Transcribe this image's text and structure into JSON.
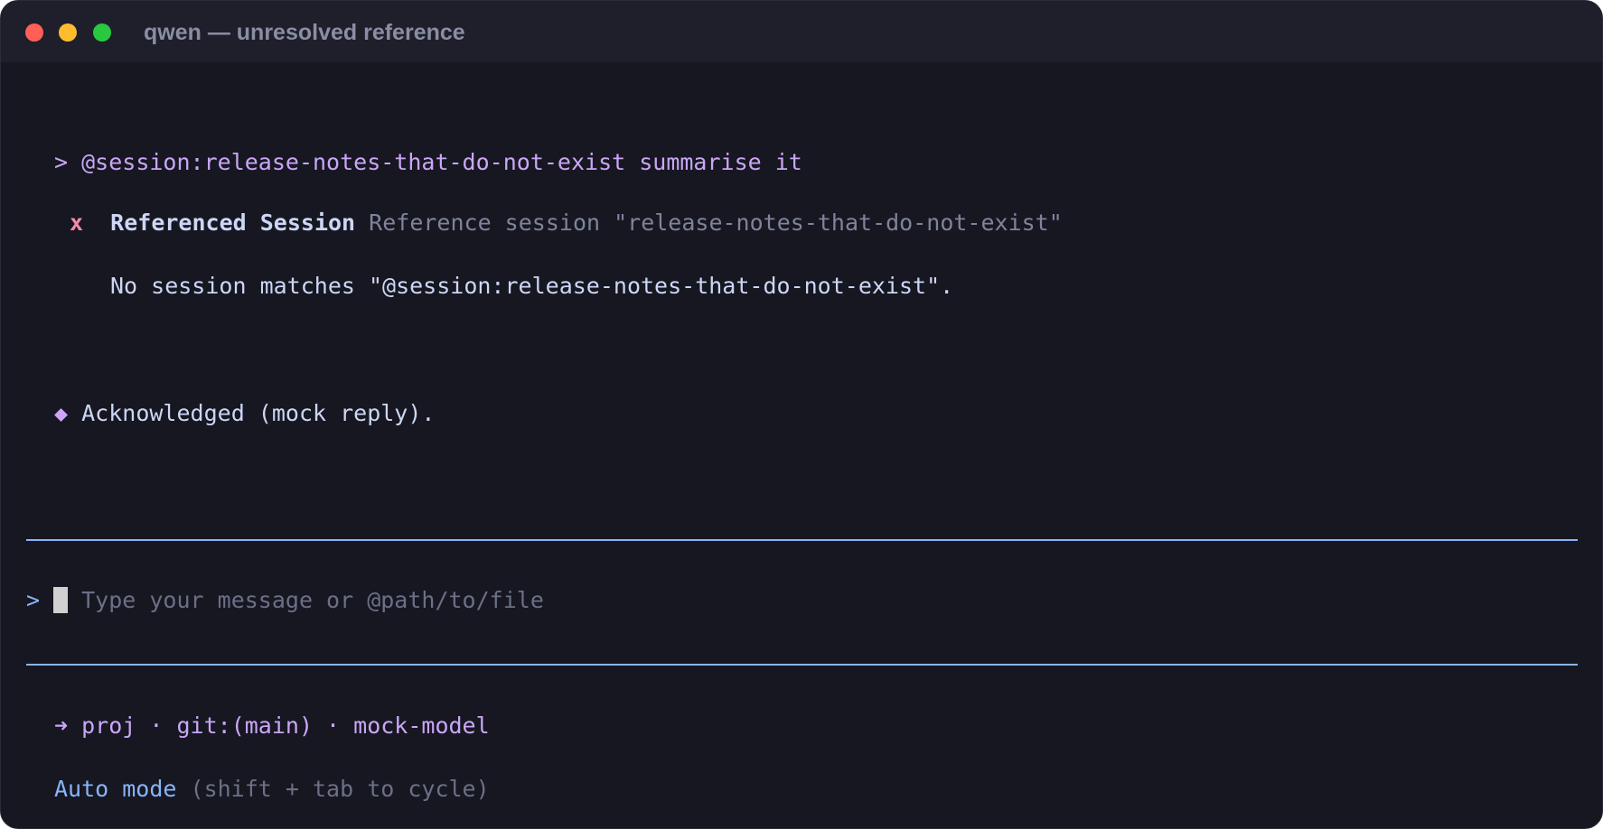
{
  "window": {
    "title": "qwen — unresolved reference",
    "controls": {
      "close_color": "#ff5f57",
      "minimize_color": "#febc2e",
      "maximize_color": "#28c840"
    }
  },
  "conversation": {
    "user_prompt": {
      "caret": ">",
      "text": "@session:release-notes-that-do-not-exist summarise it"
    },
    "tool_call": {
      "status_icon": "x",
      "status": "error",
      "name": "Referenced Session",
      "description": "Reference session \"release-notes-that-do-not-exist\"",
      "error_message": "No session matches \"@session:release-notes-that-do-not-exist\"."
    },
    "assistant_reply": {
      "icon": "◆",
      "text": "Acknowledged (mock reply)."
    }
  },
  "input": {
    "caret": ">",
    "value": "",
    "placeholder": "Type your message or @path/to/file"
  },
  "status_bar": {
    "arrow": "➜",
    "text": "proj · git:(main) · mock-model"
  },
  "mode": {
    "name": "Auto mode",
    "hint": "(shift + tab to cycle)"
  },
  "colors": {
    "background": "#161721",
    "titlebar": "#1e1f2b",
    "accent_purple": "#cba6f7",
    "accent_blue": "#89b4fa",
    "error_red": "#f38ba8",
    "text": "#cdd6f4",
    "muted": "#7f849c"
  }
}
